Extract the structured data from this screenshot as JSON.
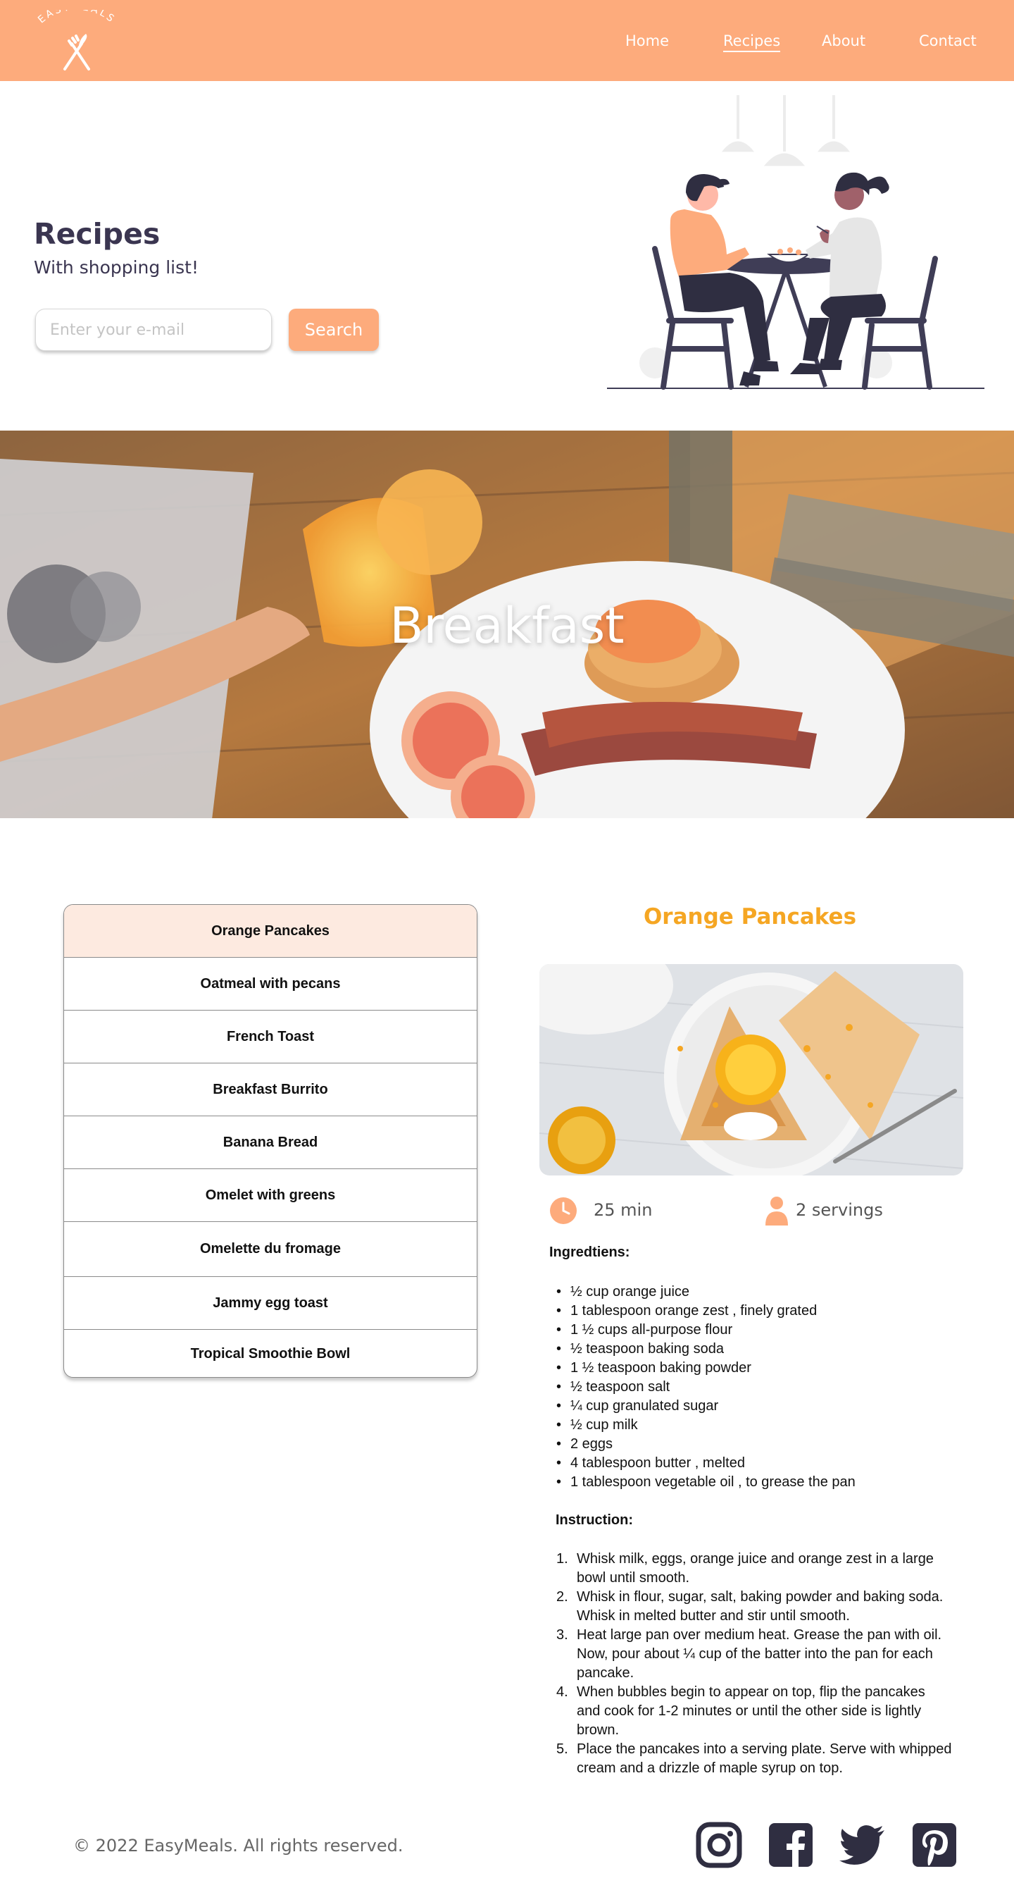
{
  "brand": {
    "name": "EASYMEALS"
  },
  "nav": {
    "home": "Home",
    "recipes": "Recipes",
    "about": "About",
    "contact": "Contact"
  },
  "hero": {
    "title": "Recipes",
    "subtitle": "With shopping list!",
    "email_placeholder": "Enter your e-mail",
    "search_label": "Search"
  },
  "banner": {
    "title": "Breakfast"
  },
  "recipes": [
    "Orange Pancakes",
    "Oatmeal with pecans",
    "French Toast",
    "Breakfast Burrito",
    "Banana Bread",
    "Omelet with greens",
    "Omelette du fromage",
    "Jammy egg toast",
    "Tropical Smoothie Bowl"
  ],
  "detail": {
    "title": "Orange Pancakes",
    "time": "25 min",
    "servings": "2 servings",
    "ingredients_title": "Ingredtiens:",
    "ingredients": [
      "½ cup orange juice",
      "1 tablespoon orange zest , finely grated",
      "1 ½ cups all-purpose flour",
      "½ teaspoon baking soda",
      "1 ½ teaspoon baking powder",
      "½ teaspoon salt",
      "¼ cup granulated sugar",
      "½ cup milk",
      "2 eggs",
      "4 tablespoon butter , melted",
      "1 tablespoon vegetable oil , to grease the pan"
    ],
    "instructions_title": "Instruction:",
    "instructions": [
      {
        "num": "1.",
        "lines": [
          "Whisk milk, eggs, orange juice and orange zest in a large",
          "bowl until smooth."
        ]
      },
      {
        "num": "2.",
        "lines": [
          "Whisk in flour, sugar, salt, baking powder and baking soda.",
          "Whisk in melted butter and stir until smooth."
        ]
      },
      {
        "num": "3.",
        "lines": [
          "Heat large pan over medium heat. Grease the pan with oil.",
          "Now, pour about ¼ cup of the batter into the pan for each",
          "pancake."
        ]
      },
      {
        "num": "4.",
        "lines": [
          "When bubbles begin to appear on top, flip the pancakes",
          "and cook for 1-2 minutes or until the other side is lightly",
          "brown."
        ]
      },
      {
        "num": "5.",
        "lines": [
          "Place the pancakes into a serving plate. Serve with whipped",
          "cream and a drizzle of maple syrup on top."
        ]
      }
    ]
  },
  "footer": {
    "copyright": "© 2022 EasyMeals. All rights reserved."
  },
  "social": [
    "instagram-icon",
    "facebook-icon",
    "twitter-icon",
    "pinterest-icon"
  ],
  "colors": {
    "accent": "#fdab7c",
    "title_orange": "#f5a623",
    "selected_bg": "#fdeae0",
    "dark_navy": "#3a3550"
  }
}
